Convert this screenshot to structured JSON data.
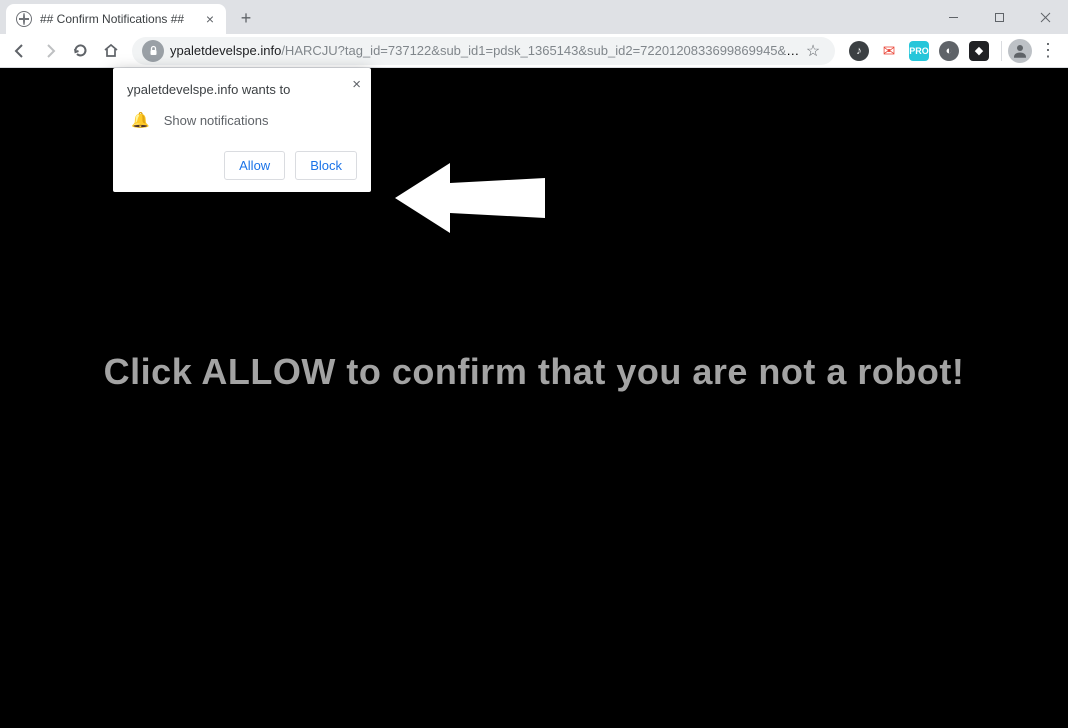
{
  "tab": {
    "title": "## Confirm Notifications ##"
  },
  "url": {
    "domain": "ypaletdevelspe.info",
    "path": "/HARCJU?tag_id=737122&sub_id1=pdsk_1365143&sub_id2=7220120833699869945&cookie_id=8f23bb50-030..."
  },
  "permission": {
    "header": "ypaletdevelspe.info wants to",
    "line": "Show notifications",
    "allow": "Allow",
    "block": "Block"
  },
  "page": {
    "headline": "Click ALLOW to confirm that you are not a robot!"
  },
  "ext": {
    "teal_label": "PRO"
  }
}
